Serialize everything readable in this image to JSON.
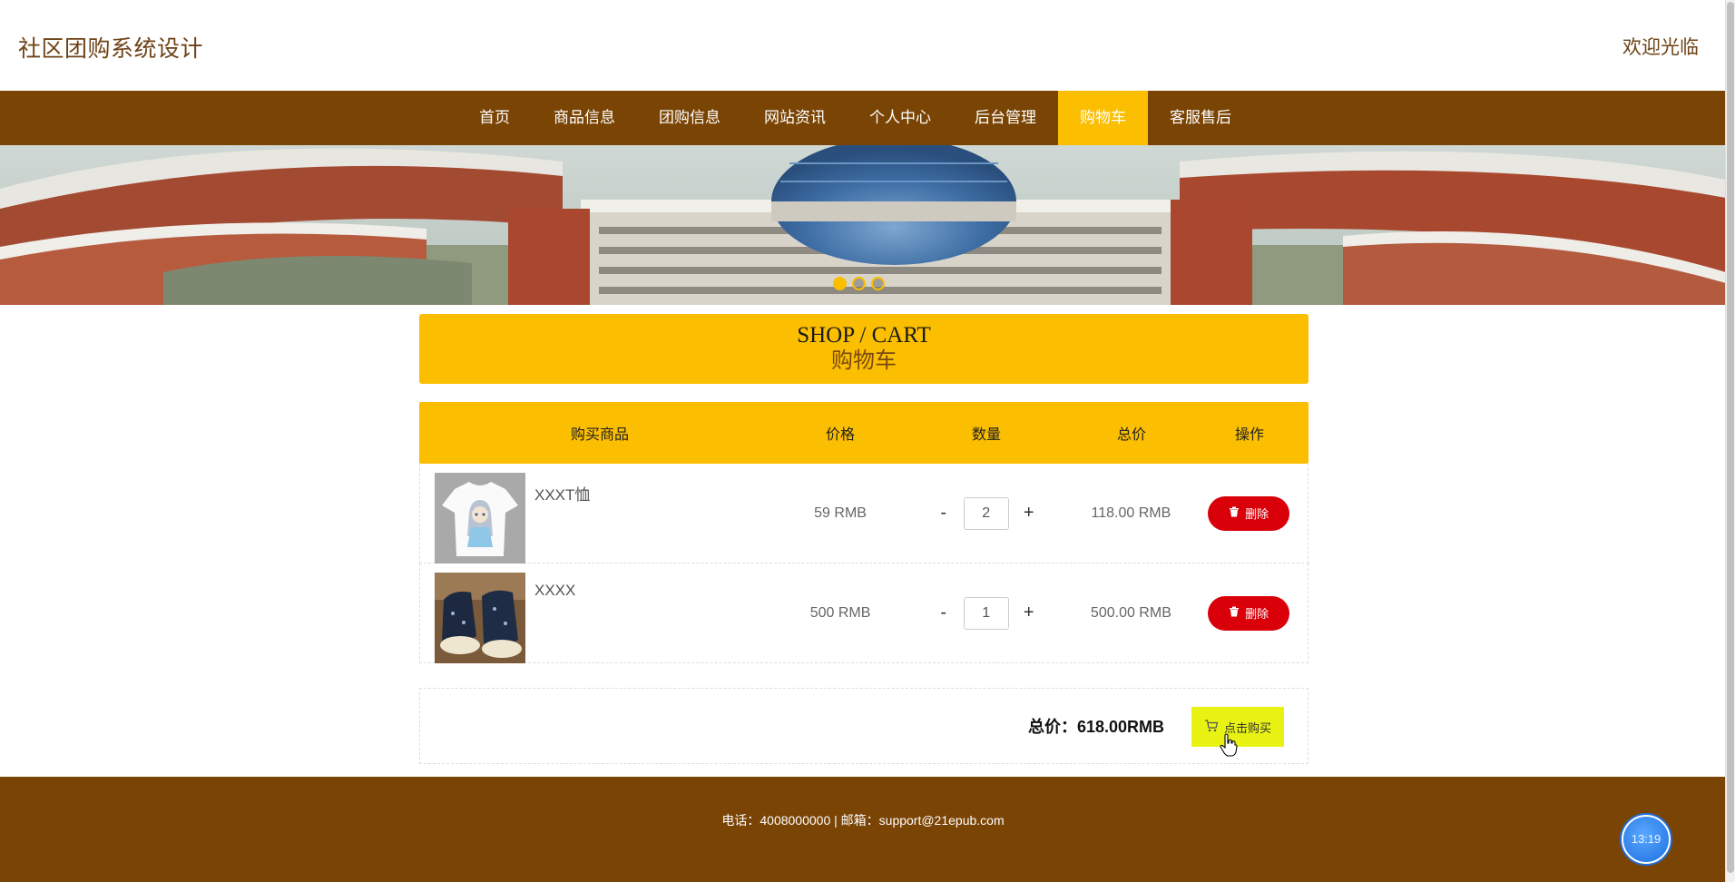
{
  "header": {
    "site_title": "社区团购系统设计",
    "welcome": "欢迎光临"
  },
  "nav": {
    "items": [
      {
        "label": "首页"
      },
      {
        "label": "商品信息"
      },
      {
        "label": "团购信息"
      },
      {
        "label": "网站资讯"
      },
      {
        "label": "个人中心"
      },
      {
        "label": "后台管理"
      },
      {
        "label": "购物车",
        "active": true
      },
      {
        "label": "客服售后"
      }
    ]
  },
  "banner": {
    "slide_count": 3,
    "active_slide": 1
  },
  "cart": {
    "title_en": "SHOP / CART",
    "title_zh": "购物车",
    "columns": [
      "购买商品",
      "价格",
      "数量",
      "总价",
      "操作"
    ],
    "items": [
      {
        "name": "XXXT恤",
        "price": "59 RMB",
        "quantity": "2",
        "total": "118.00 RMB",
        "delete_label": "删除"
      },
      {
        "name": "XXXX",
        "price": "500 RMB",
        "quantity": "1",
        "total": "500.00 RMB",
        "delete_label": "删除"
      }
    ],
    "minus_label": "-",
    "plus_label": "+",
    "summary": {
      "total_label": "总价：618.00RMB",
      "buy_label": "点击购买"
    }
  },
  "footer": {
    "text": "电话：4008000000 | 邮箱：support@21epub.com"
  },
  "clock": {
    "time": "13:19"
  },
  "colors": {
    "brown": "#7a4405",
    "accent": "#fbbe00",
    "delete": "#d9000a",
    "buy": "#e8f213"
  }
}
